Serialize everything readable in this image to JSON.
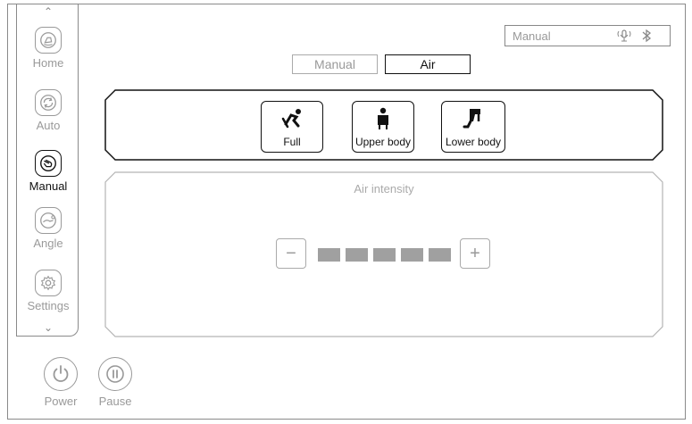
{
  "sidebar": {
    "items": [
      {
        "label": "Home",
        "icon": "home-hand-icon",
        "active": false
      },
      {
        "label": "Auto",
        "icon": "auto-cycle-icon",
        "active": false
      },
      {
        "label": "Manual",
        "icon": "manual-hand-icon",
        "active": true
      },
      {
        "label": "Angle",
        "icon": "recline-angle-icon",
        "active": false
      },
      {
        "label": "Settings",
        "icon": "gear-icon",
        "active": false
      }
    ]
  },
  "status_bar": {
    "mode_label": "Manual",
    "icons": [
      "voice-icon",
      "bluetooth-icon"
    ]
  },
  "tabs": [
    {
      "label": "Manual",
      "active": false
    },
    {
      "label": "Air",
      "active": true
    }
  ],
  "modes": [
    {
      "label": "Full",
      "icon": "full-body-recline-icon"
    },
    {
      "label": "Upper body",
      "icon": "upper-body-icon"
    },
    {
      "label": "Lower body",
      "icon": "lower-body-icon"
    }
  ],
  "intensity": {
    "title": "Air intensity",
    "minus_label": "−",
    "plus_label": "+",
    "level": 5,
    "max_level": 5
  },
  "bottom": {
    "power_label": "Power",
    "pause_label": "Pause"
  },
  "colors": {
    "active": "#111111",
    "inactive": "#9a9a9a",
    "level_fill": "#a0a0a0"
  }
}
